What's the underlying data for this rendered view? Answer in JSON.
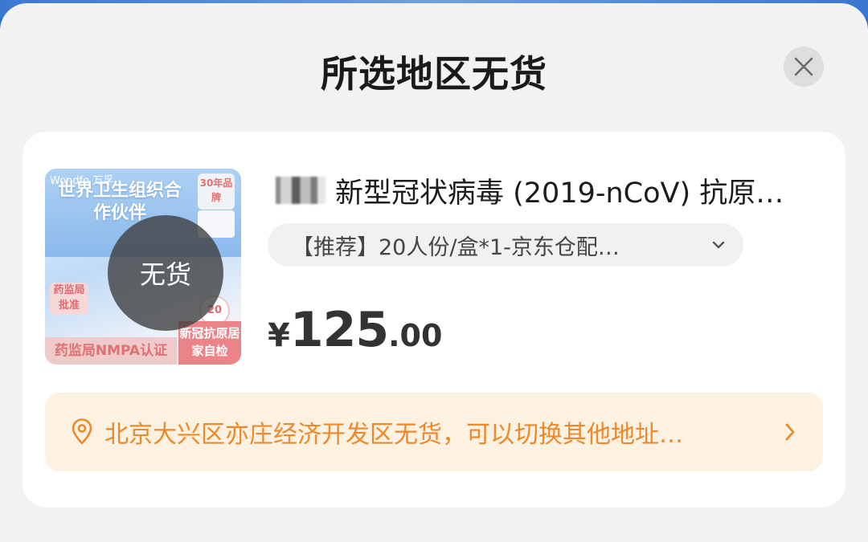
{
  "modal": {
    "title": "所选地区无货"
  },
  "product": {
    "name": "新型冠状病毒 (2019-nCoV) 抗原…",
    "spec": "【推荐】20人份/盒*1-京东仓配…",
    "price": {
      "currency": "¥",
      "integer": "125",
      "decimal": ".00"
    },
    "status_badge": "无货",
    "thumbnail": {
      "brand": "Wondfo 万孚",
      "headline": "世界卫生组织合作伙伴",
      "years_badge": "30年品牌",
      "approval_tag": "药监局批准",
      "count_badge": "20",
      "bottom_left": "药监局NMPA认证",
      "bottom_right": "新冠抗原居家自检"
    }
  },
  "notice": {
    "text": "北京大兴区亦庄经济开发区无货，可以切换其他地址…"
  },
  "colors": {
    "accent_orange": "#ec8a2b",
    "notice_bg": "#fdf1e2",
    "sheet_bg": "#f2f2f2"
  },
  "icons": {
    "close": "close-icon",
    "chevron_down": "chevron-down-icon",
    "location": "location-pin-icon",
    "chevron_right": "chevron-right-icon"
  }
}
